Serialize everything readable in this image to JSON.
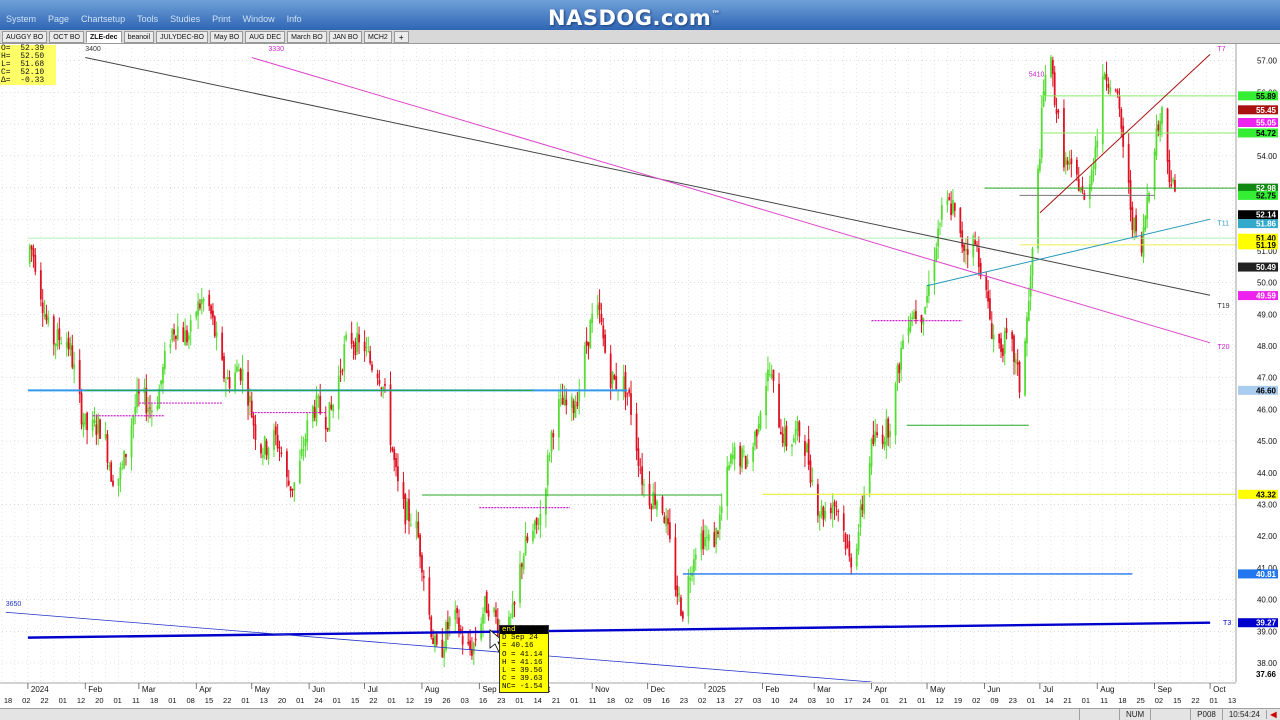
{
  "brand": {
    "name": "NASDOG.com",
    "trademark": "™"
  },
  "menu": [
    "System",
    "Page",
    "Chartsetup",
    "Tools",
    "Studies",
    "Print",
    "Window",
    "Info"
  ],
  "tabs": [
    {
      "label": "AUGGY BO",
      "active": false
    },
    {
      "label": "OCT BO",
      "active": false
    },
    {
      "label": "ZLE-dec",
      "active": true
    },
    {
      "label": "beanoil",
      "active": false
    },
    {
      "label": "JULYDEC-BO",
      "active": false
    },
    {
      "label": "May BO",
      "active": false
    },
    {
      "label": "AUG DEC",
      "active": false
    },
    {
      "label": "March BO",
      "active": false
    },
    {
      "label": "JAN BO",
      "active": false
    },
    {
      "label": "MCH2",
      "active": false
    }
  ],
  "tab_add_label": "+",
  "ohlc_box": [
    "O=  52.39",
    "H=  52.50",
    "L=  51.68",
    "C=  52.10",
    "Δ=  -0.33"
  ],
  "tooltip": {
    "title": "end",
    "lines": [
      "D Sep 24",
      "= 40.16",
      "O = 41.14",
      "H = 41.16",
      "L = 39.56",
      "C = 39.63",
      "NC= -1.54"
    ]
  },
  "status": {
    "num": "NUM",
    "page": "P008",
    "time": "10:54:24"
  },
  "chart_data": {
    "type": "candlestick",
    "ylim": [
      37.4,
      57.4
    ],
    "y_ticks": [
      38,
      39,
      40,
      41,
      42,
      43,
      44,
      45,
      46,
      47,
      48,
      49,
      50,
      51,
      52,
      53,
      54,
      55,
      56,
      57
    ],
    "y_tick_labels": [
      "38.00",
      "39.00",
      "40.00",
      "41.00",
      "42.00",
      "43.00",
      "44.00",
      "45.00",
      "46.00",
      "47.00",
      "48.00",
      "49.00",
      "50.00",
      "51.00",
      "52.00",
      "53.00",
      "54.00",
      "55.00",
      "56.00",
      "57.00"
    ],
    "price_tags": [
      {
        "value": 55.89,
        "label": "55.89",
        "bg": "#33ee33",
        "fg": "#000000"
      },
      {
        "value": 55.45,
        "label": "55.45",
        "bg": "#aa1111",
        "fg": "#ffffff"
      },
      {
        "value": 55.05,
        "label": "55.05",
        "bg": "#ee22ee",
        "fg": "#ffffff"
      },
      {
        "value": 54.72,
        "label": "54.72",
        "bg": "#33ee33",
        "fg": "#000000"
      },
      {
        "value": 52.98,
        "label": "52.98",
        "bg": "#118811",
        "fg": "#ffffff"
      },
      {
        "value": 52.75,
        "label": "52.75",
        "bg": "#33ee33",
        "fg": "#000000"
      },
      {
        "value": 52.14,
        "label": "52.14",
        "bg": "#000000",
        "fg": "#ffffff"
      },
      {
        "value": 51.86,
        "label": "51.86",
        "bg": "#33aacc",
        "fg": "#ffffff"
      },
      {
        "value": 51.4,
        "label": "51.40",
        "bg": "#ffff00",
        "fg": "#000000"
      },
      {
        "value": 51.19,
        "label": "51.19",
        "bg": "#ffff00",
        "fg": "#000000"
      },
      {
        "value": 50.49,
        "label": "50.49",
        "bg": "#222222",
        "fg": "#ffffff"
      },
      {
        "value": 49.59,
        "label": "49.59",
        "bg": "#ee22ee",
        "fg": "#ffffff"
      },
      {
        "value": 46.6,
        "label": "46.60",
        "bg": "#aaccee",
        "fg": "#000000"
      },
      {
        "value": 43.32,
        "label": "43.32",
        "bg": "#ffff00",
        "fg": "#000000"
      },
      {
        "value": 40.81,
        "label": "40.81",
        "bg": "#2277ee",
        "fg": "#ffffff"
      },
      {
        "value": 39.27,
        "label": "39.27",
        "bg": "#0000cc",
        "fg": "#ffffff"
      },
      {
        "value": 37.66,
        "label": "37.66",
        "bg": "#ffffff",
        "fg": "#000000"
      }
    ],
    "x_axis_labels": [
      "18",
      "02",
      "22",
      "01",
      "12",
      "20",
      "01",
      "11",
      "18",
      "01",
      "08",
      "15",
      "22",
      "01",
      "13",
      "20",
      "01",
      "24",
      "01",
      "15",
      "22",
      "01",
      "12",
      "19",
      "26",
      "03",
      "16",
      "23",
      "01",
      "14",
      "21",
      "01",
      "11",
      "18",
      "02",
      "09",
      "16",
      "23",
      "02",
      "13",
      "27",
      "03",
      "10",
      "24",
      "03",
      "10",
      "17",
      "24",
      "01",
      "21",
      "01",
      "12",
      "19",
      "02",
      "09",
      "23",
      "01",
      "14",
      "21",
      "01",
      "11",
      "18",
      "25",
      "02",
      "15",
      "22",
      "01",
      "13"
    ],
    "month_labels": [
      "2024",
      "Feb",
      "Mar",
      "Apr",
      "May",
      "Jun",
      "Jul",
      "Aug",
      "Sep",
      "Oct",
      "Nov",
      "Dec",
      "2025",
      "Feb",
      "Mar",
      "Apr",
      "May",
      "Jun",
      "Jul",
      "Aug",
      "Sep",
      "Oct"
    ],
    "annotations": [
      "3400",
      "3330",
      "3650",
      "5410",
      "T7",
      "T11",
      "T19",
      "T20",
      "T3"
    ],
    "trendlines": [
      {
        "name": "black-resistance",
        "color": "#444444",
        "from": [
          "2024-02",
          57.1
        ],
        "to": [
          "2025-10",
          49.6
        ]
      },
      {
        "name": "magenta-resistance",
        "color": "#dd44cc",
        "from": [
          "2024-05",
          57.1
        ],
        "to": [
          "2025-10",
          48.1
        ]
      },
      {
        "name": "blue-support",
        "color": "#0000cc",
        "from": [
          "2024-01",
          38.8
        ],
        "to": [
          "2025-10",
          39.27
        ]
      },
      {
        "name": "teal-support",
        "color": "#2299bb",
        "from": [
          "2025-05",
          49.9
        ],
        "to": [
          "2025-10",
          52.0
        ]
      },
      {
        "name": "darkred-rising",
        "color": "#aa1111",
        "from": [
          "2025-07",
          52.2
        ],
        "to": [
          "2025-10",
          57.2
        ]
      }
    ],
    "key_points": [
      {
        "date": "2024-01-02",
        "price": 50.6
      },
      {
        "date": "2024-02-15",
        "price": 44.0
      },
      {
        "date": "2024-04-01",
        "price": 49.4
      },
      {
        "date": "2024-05-20",
        "price": 43.8
      },
      {
        "date": "2024-07-01",
        "price": 48.6
      },
      {
        "date": "2024-08-10",
        "price": 38.6
      },
      {
        "date": "2024-09-20",
        "price": 39.6
      },
      {
        "date": "2024-10-10",
        "price": 44.9
      },
      {
        "date": "2024-11-05",
        "price": 48.8
      },
      {
        "date": "2024-12-20",
        "price": 40.2
      },
      {
        "date": "2025-02-05",
        "price": 46.6
      },
      {
        "date": "2025-03-20",
        "price": 41.6
      },
      {
        "date": "2025-04-20",
        "price": 48.2
      },
      {
        "date": "2025-05-15",
        "price": 52.6
      },
      {
        "date": "2025-06-20",
        "price": 46.6
      },
      {
        "date": "2025-07-05",
        "price": 56.8
      },
      {
        "date": "2025-07-25",
        "price": 51.9
      },
      {
        "date": "2025-08-05",
        "price": 57.1
      },
      {
        "date": "2025-08-25",
        "price": 51.1
      },
      {
        "date": "2025-09-05",
        "price": 55.5
      },
      {
        "date": "2025-09-15",
        "price": 52.1
      }
    ],
    "grid": true
  }
}
